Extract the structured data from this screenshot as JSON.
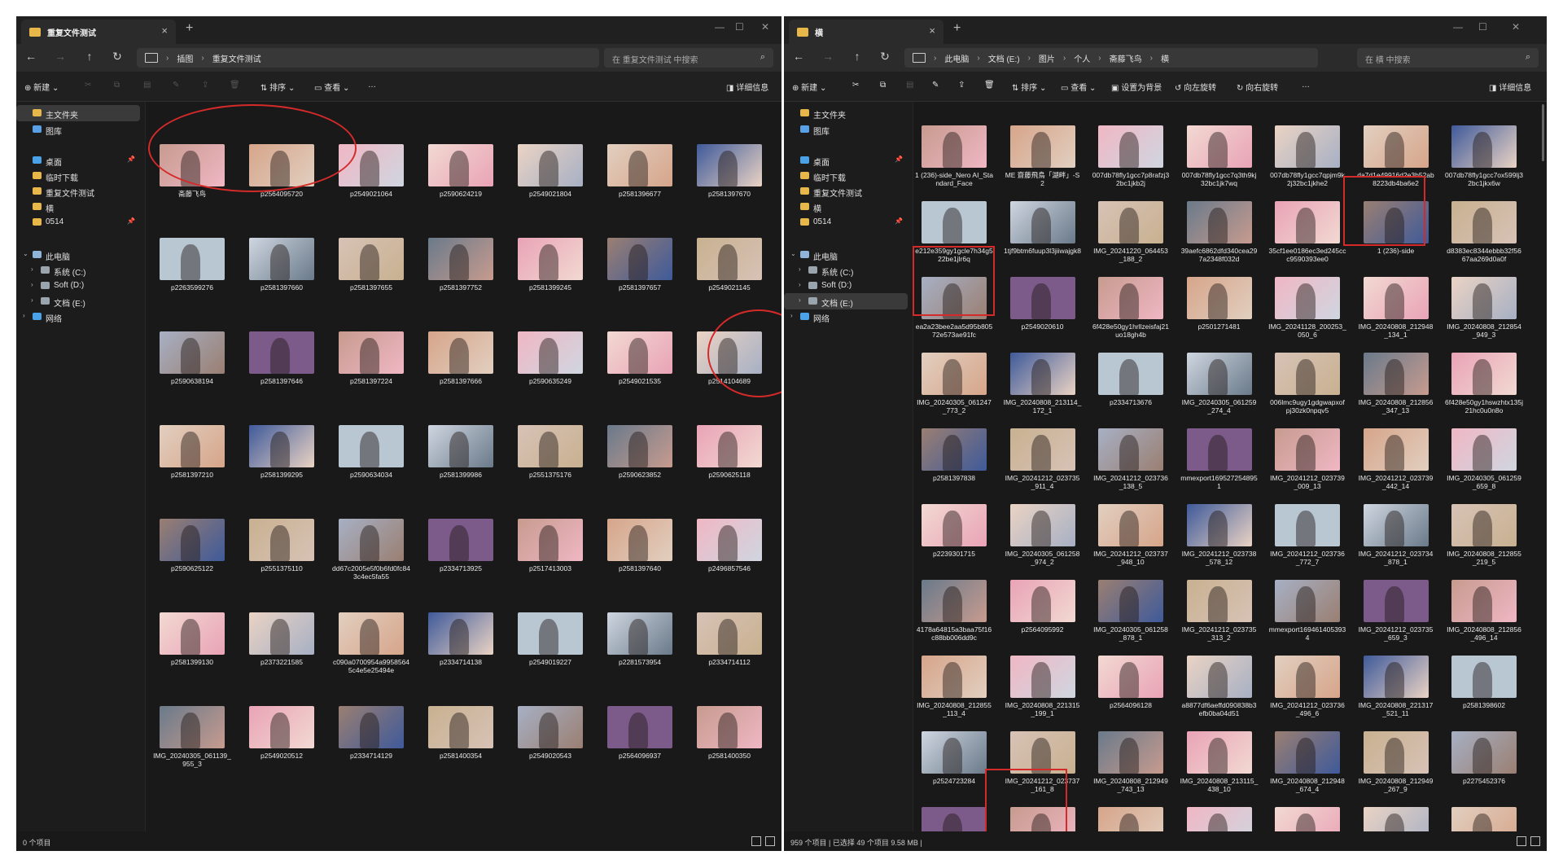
{
  "colors": {
    "accent": "#d42a2a",
    "folder": "#e8b74a"
  },
  "left": {
    "tab_title": "重复文件测试",
    "breadcrumb": [
      "插图",
      "重复文件测试"
    ],
    "search_placeholder": "在 重复文件测试 中搜索",
    "cmd": {
      "new": "新建",
      "sort": "排序",
      "view": "查看",
      "more": "…",
      "details": "详细信息"
    },
    "sidebar": [
      {
        "label": "主文件夹",
        "icon": "home-icon",
        "sel": true,
        "indent": 0
      },
      {
        "label": "图库",
        "icon": "gallery-icon",
        "indent": 0
      },
      {
        "label": "桌面",
        "icon": "desktop-icon",
        "pin": true,
        "indent": 0
      },
      {
        "label": "临时下载",
        "icon": "folder-icon",
        "indent": 0
      },
      {
        "label": "重复文件测试",
        "icon": "folder-icon",
        "indent": 0
      },
      {
        "label": "横",
        "icon": "folder-icon",
        "indent": 0
      },
      {
        "label": "0514",
        "icon": "folder-icon",
        "pin": true,
        "indent": 0
      },
      {
        "label": "此电脑",
        "icon": "pc-icon",
        "chev": "expand",
        "indent": 0
      },
      {
        "label": "系统 (C:)",
        "icon": "drive-icon",
        "chev": "collapse",
        "indent": 1
      },
      {
        "label": "Soft (D:)",
        "icon": "drive-icon",
        "chev": "collapse",
        "indent": 1
      },
      {
        "label": "文档 (E:)",
        "icon": "drive-icon",
        "chev": "collapse",
        "indent": 1
      },
      {
        "label": "网络",
        "icon": "network-icon",
        "chev": "collapse",
        "indent": 0
      }
    ],
    "files": [
      "斋藤飞鸟",
      "p2564095720",
      "p2549021064",
      "p2590624219",
      "p2549021804",
      "p2581396677",
      "p2581397670",
      "p2263599276",
      "p2581397660",
      "p2581397655",
      "p2581397752",
      "p2581399245",
      "p2581397657",
      "p2549021145",
      "p2590638194",
      "p2581397646",
      "p2581397224",
      "p2581397666",
      "p2590635249",
      "p2549021535",
      "p2514104689",
      "p2581397210",
      "p2581399295",
      "p2590634034",
      "p2581399986",
      "p2551375176",
      "p2590623852",
      "p2590625118",
      "p2590625122",
      "p2551375110",
      "dd67c2005e5f0b6fd0fc843c4ec5fa55",
      "p2334713925",
      "p2517413003",
      "p2581397640",
      "p2496857546",
      "p2581399130",
      "p2373221585",
      "c090a0700954a99585645c4e5e25494e",
      "p2334714138",
      "p2549019227",
      "p2281573954",
      "p2334714112",
      "IMG_20240305_061139_955_3",
      "p2549020512",
      "p2334714129",
      "p2581400354",
      "p2549020543",
      "p2564096937",
      "p2581400350"
    ],
    "status": "0 个项目"
  },
  "right": {
    "tab_title": "横",
    "breadcrumb": [
      "此电脑",
      "文档 (E:)",
      "图片",
      "个人",
      "斋藤飞鸟",
      "横"
    ],
    "search_placeholder": "在 横 中搜索",
    "cmd": {
      "new": "新建",
      "sort": "排序",
      "view": "查看",
      "set_bg": "设置为背景",
      "rotate_left": "向左旋转",
      "rotate_right": "向右旋转",
      "more": "…",
      "details": "详细信息"
    },
    "sidebar": [
      {
        "label": "主文件夹",
        "icon": "home-icon",
        "indent": 0
      },
      {
        "label": "图库",
        "icon": "gallery-icon",
        "indent": 0
      },
      {
        "label": "桌面",
        "icon": "desktop-icon",
        "pin": true,
        "indent": 0
      },
      {
        "label": "临时下载",
        "icon": "folder-icon",
        "indent": 0
      },
      {
        "label": "重复文件测试",
        "icon": "folder-icon",
        "indent": 0
      },
      {
        "label": "横",
        "icon": "folder-icon",
        "indent": 0
      },
      {
        "label": "0514",
        "icon": "folder-icon",
        "pin": true,
        "indent": 0
      },
      {
        "label": "此电脑",
        "icon": "pc-icon",
        "chev": "expand",
        "indent": 0
      },
      {
        "label": "系统 (C:)",
        "icon": "drive-icon",
        "chev": "collapse",
        "indent": 1
      },
      {
        "label": "Soft (D:)",
        "icon": "drive-icon",
        "chev": "collapse",
        "indent": 1
      },
      {
        "label": "文档 (E:)",
        "icon": "drive-icon",
        "chev": "collapse",
        "sel": true,
        "indent": 1
      },
      {
        "label": "网络",
        "icon": "network-icon",
        "chev": "collapse",
        "indent": 0
      }
    ],
    "files": [
      "1 (236)-side_Nero AI_Standard_Face",
      "ME 齋藤飛鳥「湖畔」-S2",
      "007db78fly1gcc7p8rafzj32bc1jkb2j",
      "007db78fly1gcc7q3th9kj32bc1jk7wq",
      "007db78fly1gcc7qpjm9k2j32bc1jkhe2",
      "da7d1e49916d2e3b52ab8223db4ba6e2",
      "007db78fly1gcc7ox599lj32bc1jkx6w",
      "e212e359gy1gcle7h34g522be1jlr6q",
      "1tjf9btm6fuup3l3jiiwajgk8",
      "IMG_20241220_064453_188_2",
      "39aefc6862dfd340cea297a2348f032d",
      "35cf1ee0186ec3ed245ccc9590393ee0",
      "1 (236)-side",
      "d8383ec8344ebbb32f5667aa269d0a0f",
      "ea2a23bee2aa5d95b80572e573ae91fc",
      "p2549020610",
      "6f428e50gy1hrllzeisfaj21uo18gh4b",
      "p2501271481",
      "IMG_20241128_200253_050_6",
      "IMG_20240808_212948_134_1",
      "IMG_20240808_212854_949_3",
      "IMG_20240305_061247_773_2",
      "IMG_20240808_213114_172_1",
      "p2334713676",
      "IMG_20240305_061259_274_4",
      "006lmc9ugy1gdgwapxofpj30zk0npqv5",
      "IMG_20240808_212856_347_13",
      "6f428e50gy1hswzhtx135j21hc0u0n8o",
      "p2581397838",
      "IMG_20241212_023735_911_4",
      "IMG_20241212_023736_138_5",
      "mmexport1695272548951",
      "IMG_20241212_023739_009_13",
      "IMG_20241212_023739_442_14",
      "IMG_20240305_061259_659_8",
      "p2239301715",
      "IMG_20240305_061258_974_2",
      "IMG_20241212_023737_948_10",
      "IMG_20241212_023738_578_12",
      "IMG_20241212_023736_772_7",
      "IMG_20241212_023734_878_1",
      "IMG_20240808_212855_219_5",
      "4178a64815a3baa75f16c88bb006dd9c",
      "p2564095992",
      "IMG_20240305_061258_878_1",
      "IMG_20241212_023735_313_2",
      "mmexport1694614053934",
      "IMG_20241212_023735_659_3",
      "IMG_20240808_212856_496_14",
      "IMG_20240808_212855_113_4",
      "IMG_20240808_221315_199_1",
      "p2564096128",
      "a8877df6aeffd090838b3efb0ba04d51",
      "IMG_20241212_023736_496_6",
      "IMG_20240808_221317_521_11",
      "p2581398602",
      "p2524723284",
      "IMG_20241212_023737_161_8",
      "IMG_20240808_212949_743_13",
      "IMG_20240808_213115_438_10",
      "IMG_20240808_212948_674_4",
      "IMG_20240808_212949_267_9",
      "p2275452376",
      "",
      "",
      "",
      "",
      "",
      "",
      ""
    ],
    "status": "959 个项目  |  已选择 49 个项目  9.58 MB  |"
  }
}
